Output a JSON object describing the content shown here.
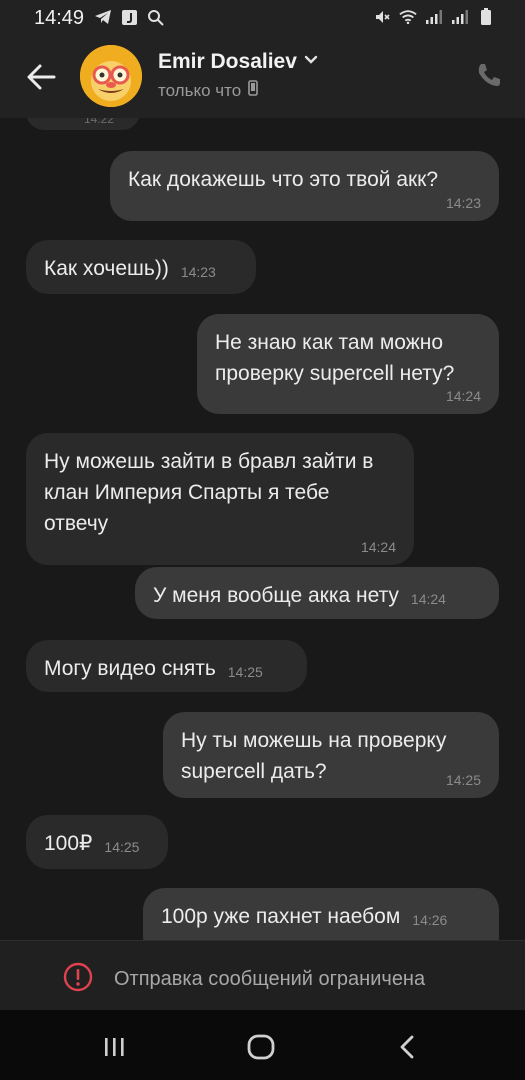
{
  "status_bar": {
    "time": "14:49",
    "left_icons": [
      "telegram-icon",
      "app-j-icon",
      "search-icon"
    ],
    "right_icons": [
      "mute-icon",
      "wifi-icon",
      "signal-icon",
      "signal-icon",
      "battery-icon"
    ]
  },
  "header": {
    "contact_name": "Emir Dosaliev",
    "status": "только что",
    "accent": "#f2b425"
  },
  "chat": {
    "partial_time": "14:22",
    "messages": [
      {
        "dir": "out",
        "text": "Как докажешь что это твой акк?",
        "time": "14:23"
      },
      {
        "dir": "in",
        "text": "Как хочешь))",
        "time": "14:23"
      },
      {
        "dir": "out",
        "text": "Не знаю как там можно проверку supercell нету?",
        "time": "14:24"
      },
      {
        "dir": "in",
        "text": "Ну можешь зайти в бравл зайти в клан Империя Спарты я тебе отвечу",
        "time": "14:24"
      },
      {
        "dir": "out",
        "text": "У меня вообще акка нету",
        "time": "14:24"
      },
      {
        "dir": "in",
        "text": "Могу видео снять",
        "time": "14:25"
      },
      {
        "dir": "out",
        "text": "Ну ты можешь на проверку supercell дать?",
        "time": "14:25"
      },
      {
        "dir": "in",
        "text": "100₽",
        "time": "14:25"
      },
      {
        "dir": "out",
        "text": "100р уже пахнет наебом",
        "time": "14:26"
      }
    ]
  },
  "restriction": {
    "text": "Отправка сообщений ограничена",
    "color": "#e0424f"
  }
}
